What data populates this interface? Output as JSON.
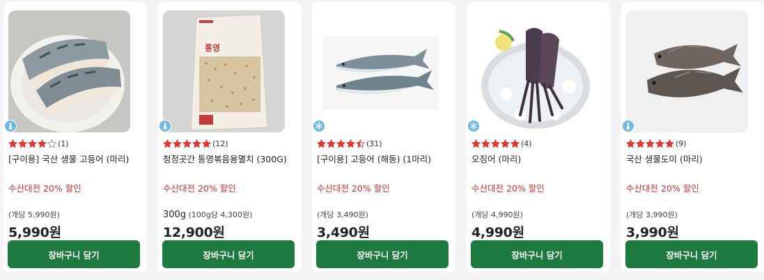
{
  "colors": {
    "button_green": "#1c7a3f",
    "promo_red": "#d7322d",
    "star_red": "#e0352b",
    "storage_badge_blue": "#6fb9e3"
  },
  "products": [
    {
      "storage_icon": "thermometer-icon",
      "rating": 4,
      "rating_count": "(1)",
      "title": "[구이용] 국산 생물 고등어 (마리)",
      "promo": "수산대전 20% 할인",
      "unit_main": "",
      "unit_price": "(개당 5,990원)",
      "price": "5,990원",
      "button_label": "장바구니 담기",
      "image": "mackerel-fillet-on-plate"
    },
    {
      "storage_icon": "thermometer-icon",
      "rating": 5,
      "rating_count": "(12)",
      "title": "청정곳간 통영볶음용멸치 (300G)",
      "promo": "수산대전 20% 할인",
      "unit_main": "300g",
      "unit_price": " (100g당 4,300원)",
      "price": "12,900원",
      "button_label": "장바구니 담기",
      "image": "anchovy-package"
    },
    {
      "storage_icon": "snowflake-icon",
      "rating": 4.5,
      "rating_count": "(31)",
      "title": "[구이용] 고등어 (해동) (1마리)",
      "promo": "수산대전 20% 할인",
      "unit_main": "",
      "unit_price": "(개당 3,490원)",
      "price": "3,490원",
      "button_label": "장바구니 담기",
      "image": "two-whole-mackerel"
    },
    {
      "storage_icon": "snowflake-icon",
      "rating": 5,
      "rating_count": "(4)",
      "title": "오징어 (마리)",
      "promo": "수산대전 20% 할인",
      "unit_main": "",
      "unit_price": "(개당 4,990원)",
      "price": "4,990원",
      "button_label": "장바구니 담기",
      "image": "squid-on-ice-plate"
    },
    {
      "storage_icon": "thermometer-icon",
      "rating": 5,
      "rating_count": "(9)",
      "title": "국산 생물도미 (마리)",
      "promo": "수산대전 20% 할인",
      "unit_main": "",
      "unit_price": "(개당 3,990원)",
      "price": "3,990원",
      "button_label": "장바구니 담기",
      "image": "two-sea-bream"
    }
  ]
}
